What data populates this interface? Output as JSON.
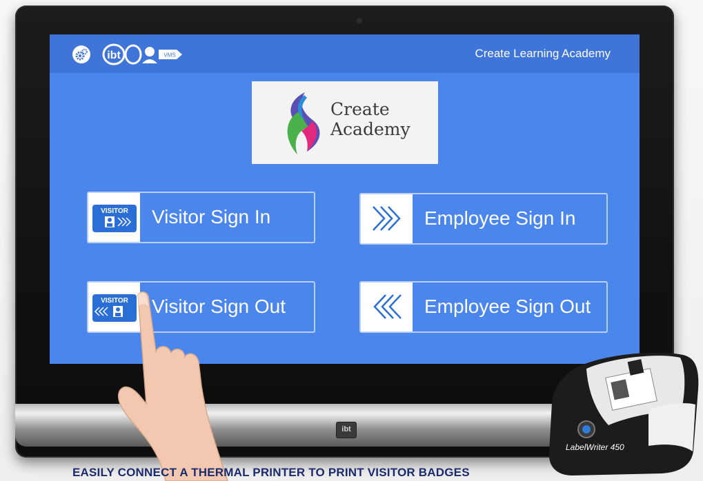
{
  "header": {
    "org_name": "Create Learning Academy",
    "logo_text": "ibt",
    "logo_suffix": "VMS"
  },
  "academy_logo": {
    "line1": "Create",
    "line2": "Academy"
  },
  "tiles": [
    {
      "label": "Visitor Sign In",
      "icon": "visitor-badge-in-icon",
      "badge_text": "VISITOR"
    },
    {
      "label": "Employee Sign In",
      "icon": "chevrons-right-icon"
    },
    {
      "label": "Visitor Sign Out",
      "icon": "visitor-badge-out-icon",
      "badge_text": "VISITOR"
    },
    {
      "label": "Employee Sign Out",
      "icon": "chevrons-left-icon"
    }
  ],
  "bezel_logo": "ibt",
  "printer": {
    "model": "LabelWriter 450"
  },
  "caption": "EASILY CONNECT A THERMAL PRINTER TO PRINT VISITOR BADGES",
  "colors": {
    "screen_bg": "#4b86ec",
    "header_bg": "#3f74d8",
    "tile_border": "#b9cff6",
    "caption": "#1a2a6c"
  }
}
